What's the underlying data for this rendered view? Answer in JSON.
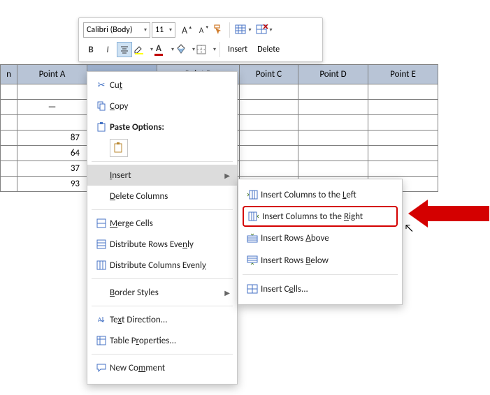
{
  "mini_toolbar": {
    "font_name": "Calibri (Body)",
    "font_size": "11",
    "grow_font": "A",
    "shrink_font": "A",
    "insert_label": "Insert",
    "delete_label": "Delete",
    "bold": "B",
    "italic": "I"
  },
  "table": {
    "headers": [
      "n",
      "Point A",
      "",
      "Point B",
      "Point C",
      "Point D",
      "Point E"
    ],
    "rows": [
      [
        "",
        "",
        "",
        "",
        "",
        "",
        ""
      ],
      [
        "",
        "—",
        "",
        "",
        "",
        "",
        ""
      ],
      [
        "",
        "",
        "",
        "",
        "",
        "",
        ""
      ],
      [
        "",
        "87",
        "",
        "",
        "",
        "",
        ""
      ],
      [
        "",
        "64",
        "",
        "",
        "",
        "",
        ""
      ],
      [
        "",
        "37",
        "",
        "",
        "",
        "",
        ""
      ],
      [
        "",
        "93",
        "",
        "",
        "",
        "",
        ""
      ]
    ]
  },
  "ctx": {
    "cut": "Cut",
    "copy": "Copy",
    "paste_options": "Paste Options:",
    "insert": "Insert",
    "delete_columns": "Delete Columns",
    "merge_cells": "Merge Cells",
    "dist_rows": "Distribute Rows Evenly",
    "dist_cols": "Distribute Columns Evenly",
    "border_styles": "Border Styles",
    "text_direction": "Text Direction...",
    "table_properties": "Table Properties...",
    "new_comment": "New Comment"
  },
  "sub": {
    "cols_left": "Insert Columns to the Left",
    "cols_right": "Insert Columns to the Right",
    "rows_above": "Insert Rows Above",
    "rows_below": "Insert Rows Below",
    "cells": "Insert Cells..."
  }
}
